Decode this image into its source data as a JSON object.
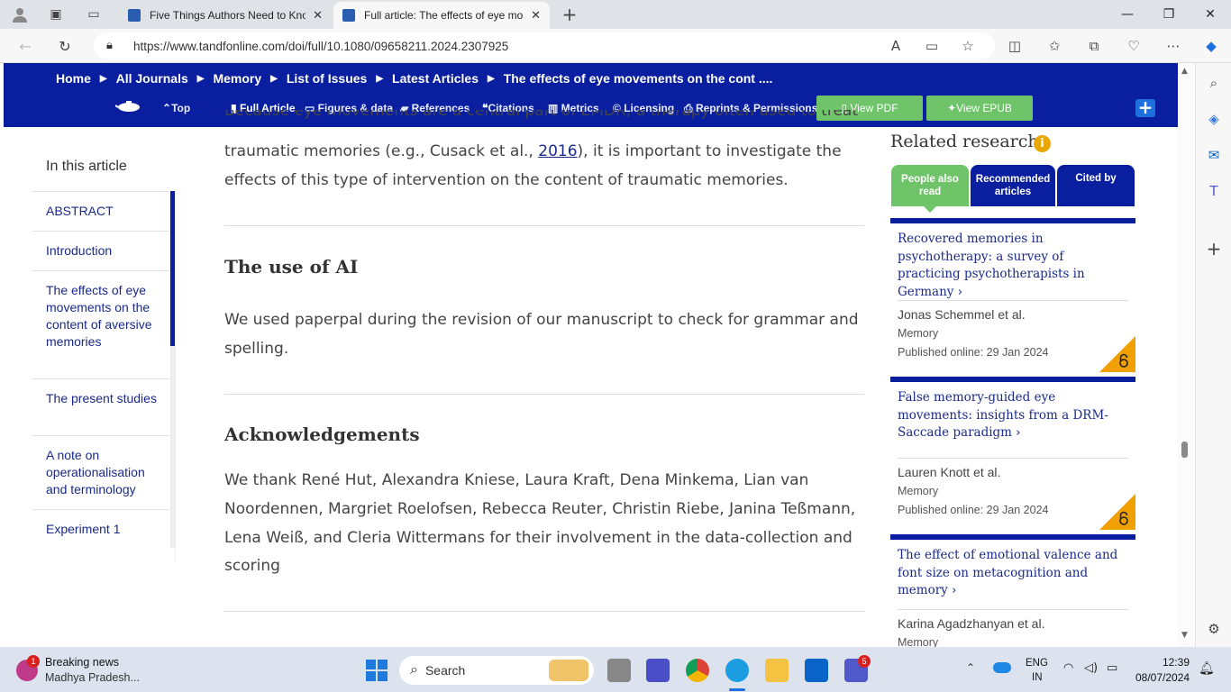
{
  "browser": {
    "tabs": [
      {
        "title": "Five Things Authors Need to Kno",
        "active": false
      },
      {
        "title": "Full article: The effects of eye mo",
        "active": true
      }
    ],
    "url": "https://www.tandfonline.com/doi/full/10.1080/09658211.2024.2307925"
  },
  "site": {
    "breadcrumbs": [
      "Home",
      "All Journals",
      "Memory",
      "List of Issues",
      "Latest Articles",
      "The effects of eye movements on the cont ...."
    ],
    "top_link": "Top",
    "tools": [
      "Full Article",
      "Figures & data",
      "References",
      "Citations",
      "Metrics",
      "Licensing",
      "Reprints & Permissions"
    ],
    "view_pdf": "View PDF",
    "view_epub": "View EPUB",
    "plus": "+"
  },
  "toc": {
    "heading": "In this article",
    "items": [
      "ABSTRACT",
      "Introduction",
      "The effects of eye movements on the content of aversive memories",
      "The present studies",
      "A note on operationalisation and terminology",
      "Experiment 1"
    ]
  },
  "article": {
    "cut_line": "Because eye movements are a central part of EMDR, a therapy often used to treat",
    "p1_a": "traumatic memories (e.g., Cusack et al., ",
    "p1_link": "2016",
    "p1_b": "), it is important to investigate the effects of this type of intervention on the content of traumatic memories.",
    "h_ai": "The use of AI",
    "p_ai": "We used paperpal during the revision of our manuscript to check for grammar and spelling.",
    "h_ack": "Acknowledgements",
    "p_ack": "We thank René Hut, Alexandra Kniese, Laura Kraft, Dena Minkema, Lian van Noordennen, Margriet Roelofsen, Rebecca Reuter, Christin Riebe, Janina Teßmann, Lena Weiß, and Cleria Wittermans for their involvement in the data-collection and scoring"
  },
  "related": {
    "title": "Related research",
    "info": "i",
    "tabs": [
      "People also read",
      "Recommended articles",
      "Cited by"
    ],
    "cards": [
      {
        "title": "Recovered memories in psychotherapy: a survey of practicing psychotherapists in Germany",
        "authors": "Jonas Schemmel et al.",
        "journal": "Memory",
        "date": "Published online: 29 Jan 2024"
      },
      {
        "title": "False memory-guided eye movements: insights from a DRM-Saccade paradigm",
        "authors": "Lauren Knott et al.",
        "journal": "Memory",
        "date": "Published online: 29 Jan 2024"
      },
      {
        "title": "The effect of emotional valence and font size on metacognition and memory",
        "authors": "Karina Agadzhanyan et al.",
        "journal": "Memory",
        "date": ""
      }
    ]
  },
  "taskbar": {
    "news_title": "Breaking news",
    "news_sub": "Madhya Pradesh...",
    "news_badge": "1",
    "search": "Search",
    "teams_badge": "5",
    "lang1": "ENG",
    "lang2": "IN",
    "time": "12:39",
    "date": "08/07/2024"
  },
  "colors": {
    "navy": "#0a1fa0",
    "green": "#6fc46a",
    "oa": "#f0a000"
  }
}
